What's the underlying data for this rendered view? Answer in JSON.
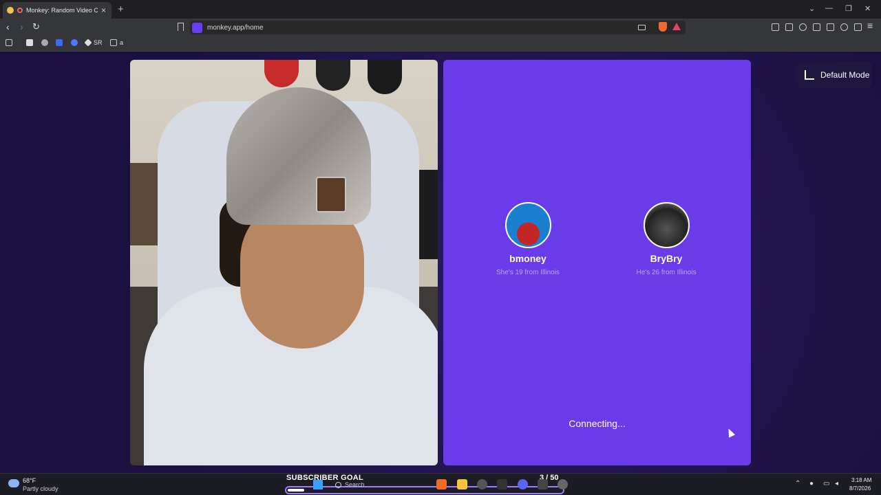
{
  "browser": {
    "tab_title": "Monkey: Random Video Chat",
    "tab_close": "×",
    "new_tab": "+",
    "url": "monkey.app/home",
    "win_controls": [
      "⌄",
      "—",
      "❐",
      "✕"
    ],
    "bookmarks": [
      {
        "label": "",
        "icon": "bookmark-favicon"
      },
      {
        "label": "",
        "icon": "globe-icon"
      },
      {
        "label": "",
        "icon": "bookmark-favicon"
      },
      {
        "label": "",
        "icon": "bookmark-favicon"
      },
      {
        "label": "SR",
        "icon": "bookmark-favicon"
      },
      {
        "label": "a",
        "icon": "folder-icon"
      }
    ]
  },
  "page": {
    "mode_button": "Default Mode",
    "connecting": "Connecting...",
    "accent": "#6a3be8",
    "profiles": [
      {
        "name": "bmoney",
        "info": "She's 19 from Illinois",
        "avatar_color": "#1a7fd0"
      },
      {
        "name": "BryBry",
        "info": "He's 26 from Illinois",
        "avatar_color": "#2a2a2a"
      }
    ]
  },
  "taskbar": {
    "weather_temp": "68°F",
    "weather_desc": "Partly cloudy",
    "subscriber_goal_label": "SUBSCRIBER GOAL",
    "subscriber_count": "3 / 50",
    "subscriber_progress": 0.06,
    "search": "Search",
    "time": "3:18 AM",
    "date": "8/7/2026"
  }
}
